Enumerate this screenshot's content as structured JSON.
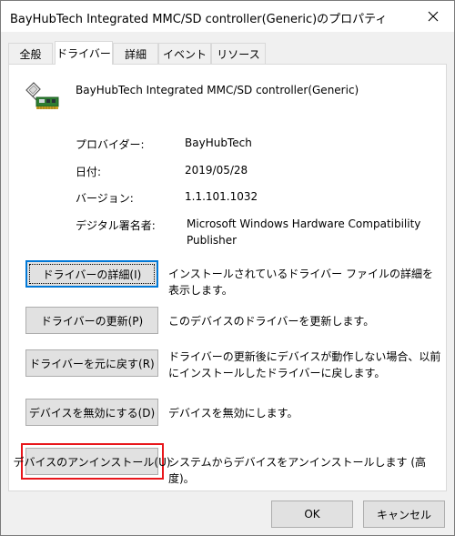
{
  "window": {
    "title": "BayHubTech Integrated MMC/SD controller(Generic)のプロパティ"
  },
  "tabs": [
    {
      "label": "全般"
    },
    {
      "label": "ドライバー"
    },
    {
      "label": "詳細"
    },
    {
      "label": "イベント"
    },
    {
      "label": "リソース"
    }
  ],
  "active_tab": "ドライバー",
  "device": {
    "name": "BayHubTech Integrated MMC/SD controller(Generic)",
    "icon": "sd-card-controller-icon"
  },
  "properties": {
    "provider_label": "プロバイダー:",
    "provider_value": "BayHubTech",
    "date_label": "日付:",
    "date_value": "2019/05/28",
    "version_label": "バージョン:",
    "version_value": "1.1.101.1032",
    "signer_label": "デジタル署名者:",
    "signer_value": "Microsoft Windows Hardware Compatibility Publisher"
  },
  "actions": [
    {
      "label": "ドライバーの詳細(I)",
      "desc": "インストールされているドライバー ファイルの詳細を表示します。"
    },
    {
      "label": "ドライバーの更新(P)",
      "desc": "このデバイスのドライバーを更新します。"
    },
    {
      "label": "ドライバーを元に戻す(R)",
      "desc": "ドライバーの更新後にデバイスが動作しない場合、以前にインストールしたドライバーに戻します。"
    },
    {
      "label": "デバイスを無効にする(D)",
      "desc": "デバイスを無効にします。"
    },
    {
      "label": "デバイスのアンインストール(U)",
      "desc": "システムからデバイスをアンインストールします (高度)。"
    }
  ],
  "footer": {
    "ok_label": "OK",
    "cancel_label": "キャンセル"
  },
  "colors": {
    "highlight": "#e8161b",
    "focus": "#0078d7"
  }
}
